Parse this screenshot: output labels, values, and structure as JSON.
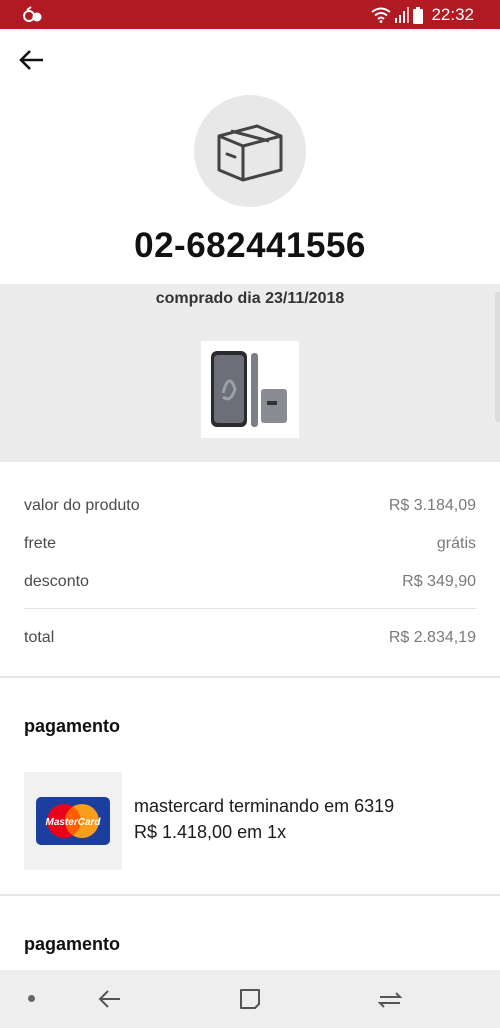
{
  "status_bar": {
    "time": "22:32"
  },
  "order": {
    "number": "02-682441556",
    "purchase_date": "comprado dia 23/11/2018"
  },
  "summary": {
    "rows": [
      {
        "label": "valor do produto",
        "value": "R$ 3.184,09"
      },
      {
        "label": "frete",
        "value": "grátis"
      },
      {
        "label": "desconto",
        "value": "R$ 349,90"
      }
    ],
    "total": {
      "label": "total",
      "value": "R$ 2.834,19"
    }
  },
  "payments": [
    {
      "title": "pagamento",
      "card_text": "mastercard terminando em 6319",
      "amount_text": "R$ 1.418,00 em 1x",
      "brand_logo_text": "MasterCard"
    },
    {
      "title": "pagamento"
    }
  ],
  "icons": {
    "back": "arrow-left-icon",
    "package": "package-box-icon",
    "nav_back": "nav-back-icon",
    "nav_home": "nav-home-icon",
    "nav_recents": "nav-recents-icon"
  },
  "colors": {
    "status_bar": "#b11a22",
    "gray_band": "#ececec",
    "mastercard_red": "#eb001b",
    "mastercard_yellow": "#f79e1b",
    "mastercard_blue": "#1b3f9e"
  }
}
